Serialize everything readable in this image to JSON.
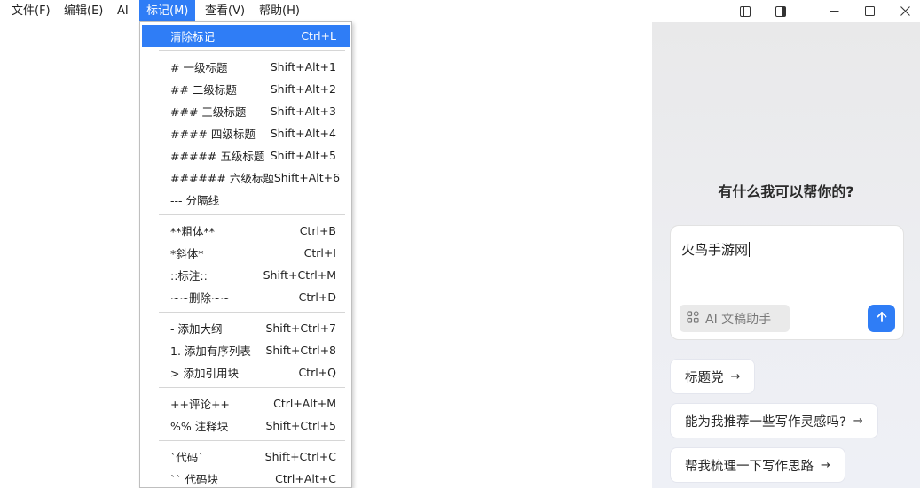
{
  "menubar": {
    "file": "文件(F)",
    "edit": "编辑(E)",
    "ai": "AI",
    "mark": "标记(M)",
    "view": "查看(V)",
    "help": "帮助(H)"
  },
  "window_controls": {
    "icons": [
      "sidebar-left-icon",
      "sidebar-right-icon",
      "minimize-icon",
      "maximize-icon",
      "close-icon"
    ]
  },
  "mark_menu": {
    "clear": {
      "label": "清除标记",
      "shortcut": "Ctrl+L"
    },
    "items": [
      {
        "label": "# 一级标题",
        "shortcut": "Shift+Alt+1"
      },
      {
        "label": "## 二级标题",
        "shortcut": "Shift+Alt+2"
      },
      {
        "label": "### 三级标题",
        "shortcut": "Shift+Alt+3"
      },
      {
        "label": "#### 四级标题",
        "shortcut": "Shift+Alt+4"
      },
      {
        "label": "##### 五级标题",
        "shortcut": "Shift+Alt+5"
      },
      {
        "label": "###### 六级标题",
        "shortcut": "Shift+Alt+6"
      },
      {
        "label": "--- 分隔线",
        "shortcut": ""
      },
      {
        "label": "**粗体**",
        "shortcut": "Ctrl+B"
      },
      {
        "label": "*斜体*",
        "shortcut": "Ctrl+I"
      },
      {
        "label": "::标注::",
        "shortcut": "Shift+Ctrl+M"
      },
      {
        "label": "~~删除~~",
        "shortcut": "Ctrl+D"
      },
      {
        "label": "- 添加大纲",
        "shortcut": "Shift+Ctrl+7"
      },
      {
        "label": "1. 添加有序列表",
        "shortcut": "Shift+Ctrl+8"
      },
      {
        "label": "> 添加引用块",
        "shortcut": "Ctrl+Q"
      },
      {
        "label": "++评论++",
        "shortcut": "Ctrl+Alt+M"
      },
      {
        "label": "%% 注释块",
        "shortcut": "Shift+Ctrl+5"
      },
      {
        "label": "`代码`",
        "shortcut": "Shift+Ctrl+C"
      },
      {
        "label": "`` 代码块",
        "shortcut": "Ctrl+Alt+C"
      }
    ]
  },
  "ai_panel": {
    "title": "有什么我可以帮你的?",
    "input_value": "火鸟手游网",
    "assistant_label": "AI 文稿助手",
    "suggestions": [
      "标题党",
      "能为我推荐一些写作灵感吗?",
      "帮我梳理一下写作思路"
    ]
  },
  "colors": {
    "accent": "#2f7df6",
    "panel_bg": "#ececed"
  }
}
